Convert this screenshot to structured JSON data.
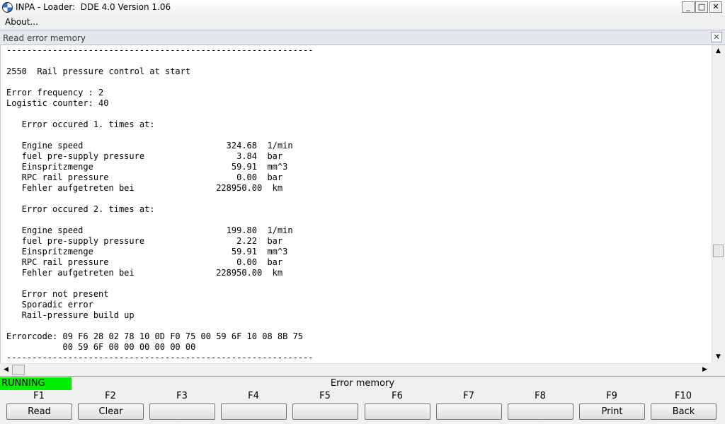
{
  "window": {
    "title": "INPA - Loader:  DDE 4.0 Version 1.06",
    "minimize": "_",
    "maximize": "□",
    "close": "✕",
    "icon": "bmw-logo-icon"
  },
  "menu": {
    "about": "About..."
  },
  "child_window": {
    "title": "Read error memory",
    "close": "✕"
  },
  "output": {
    "lines": [
      "------------------------------------------------------------",
      "",
      "2550  Rail pressure control at start",
      "",
      "Error frequency : 2",
      "Logistic counter: 40",
      "",
      "   Error occured 1. times at:",
      "",
      "   Engine speed                            324.68  1/min",
      "   fuel pre-supply pressure                  3.84  bar",
      "   Einspritzmenge                           59.91  mm^3",
      "   RPC rail pressure                         0.00  bar",
      "   Fehler aufgetreten bei                228950.00  km",
      "",
      "   Error occured 2. times at:",
      "",
      "   Engine speed                            199.80  1/min",
      "   fuel pre-supply pressure                  2.22  bar",
      "   Einspritzmenge                           59.91  mm^3",
      "   RPC rail pressure                         0.00  bar",
      "   Fehler aufgetreten bei                228950.00  km",
      "",
      "   Error not present",
      "   Sporadic error",
      "   Rail-pressure build up",
      "",
      "Errorcode: 09 F6 28 02 78 10 0D F0 75 00 59 6F 10 08 8B 75",
      "           00 59 6F 00 00 00 00 00 00",
      "------------------------------------------------------------"
    ]
  },
  "scrollbars": {
    "up": "▲",
    "down": "▼",
    "left": "◀",
    "right": "▶"
  },
  "status": {
    "state": "RUNNING",
    "state_color": "#00f000",
    "title": "Error memory"
  },
  "function_keys": [
    {
      "key": "F1",
      "label": "Read"
    },
    {
      "key": "F2",
      "label": "Clear"
    },
    {
      "key": "F3",
      "label": ""
    },
    {
      "key": "F4",
      "label": ""
    },
    {
      "key": "F5",
      "label": ""
    },
    {
      "key": "F6",
      "label": ""
    },
    {
      "key": "F7",
      "label": ""
    },
    {
      "key": "F8",
      "label": ""
    },
    {
      "key": "F9",
      "label": "Print"
    },
    {
      "key": "F10",
      "label": "Back"
    }
  ]
}
